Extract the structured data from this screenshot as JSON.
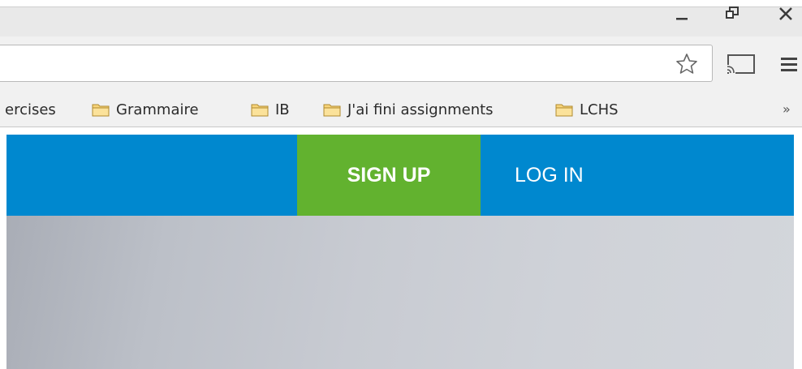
{
  "window": {
    "minimize_icon": "minimize-icon",
    "restore_icon": "restore-icon",
    "close_icon": "close-icon"
  },
  "toolbar": {
    "omnibox_value": "",
    "star_icon": "star-icon",
    "cast_icon": "cast-icon",
    "menu_icon": "hamburger-menu-icon"
  },
  "bookmarks": {
    "items": [
      {
        "label": "ercises",
        "icon": ""
      },
      {
        "label": "Grammaire",
        "icon": "folder-icon"
      },
      {
        "label": "IB",
        "icon": "folder-icon"
      },
      {
        "label": "J'ai fini assignments",
        "icon": "folder-icon"
      },
      {
        "label": "LCHS",
        "icon": "folder-icon"
      }
    ],
    "overflow": "»"
  },
  "site": {
    "signup_label": "SIGN UP",
    "login_label": "LOG IN",
    "header_color": "#0088cf",
    "signup_color": "#62b22f"
  }
}
